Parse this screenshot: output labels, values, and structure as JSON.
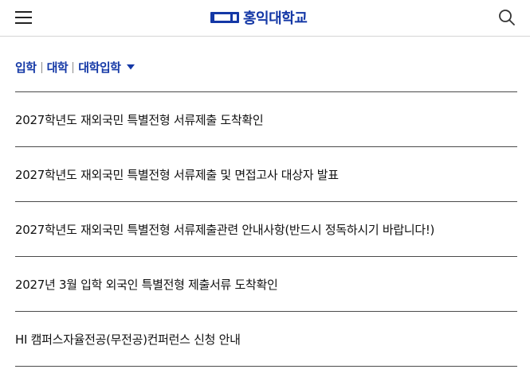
{
  "header": {
    "logo_text": "홍익대학교",
    "brand_color": "#1438a6",
    "menu_icon": "hamburger-menu-icon",
    "search_icon": "search-icon"
  },
  "breadcrumb": {
    "items": [
      "입학",
      "대학",
      "대학입학"
    ],
    "dropdown_icon": "caret-down-icon"
  },
  "posts": [
    "2027학년도 재외국민 특별전형 서류제출 도착확인",
    "2027학년도 재외국민 특별전형 서류제출 및 면접고사 대상자 발표",
    "2027학년도 재외국민 특별전형 서류제출관련 안내사항(반드시 정독하시기 바랍니다!)",
    "2027년 3월 입학 외국인 특별전형 제출서류 도착확인",
    "HI 캠퍼스자율전공(무전공)컨퍼런스 신청 안내"
  ]
}
